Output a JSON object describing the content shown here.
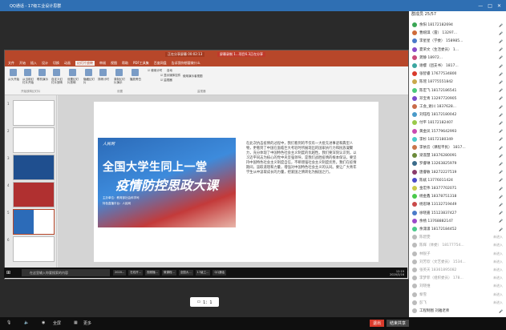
{
  "window": {
    "title": "QQ通话 - 17级工业设计思群"
  },
  "ppt": {
    "doc_label": "正在分享屏幕",
    "timer": "00:02:13",
    "recording": "屏幕录制 1...项目6.3正在分享",
    "tabs": [
      "文件",
      "开始",
      "插入",
      "设计",
      "切换",
      "动画",
      "幻灯片放映",
      "审阅",
      "视图",
      "帮助",
      "PDF工具集",
      "百度网盘",
      "告诉我你想要做什么"
    ],
    "active_tab": "幻灯片放映",
    "ribbon": [
      "从头开始",
      "从当前幻灯片开始",
      "联机演示",
      "自定义幻灯片放映",
      "设置幻灯片放映",
      "隐藏幻灯片",
      "排练计时",
      "录制幻灯片演示",
      "播放旁白",
      "使用计时",
      "显示媒体控件",
      "监视器",
      "自动",
      "使用演示者视图"
    ],
    "ribbon_groups": [
      "开始放映幻灯片",
      "设置",
      "监视器"
    ],
    "thumb_numbers": [
      "1",
      "2",
      "3",
      "4",
      "5",
      "6"
    ],
    "slide": {
      "banner_org": "人民网",
      "banner_title1": "全国大学生同上一堂",
      "banner_title2": "疫情防控思政大课",
      "banner_host": "主办单位：教育部社会科学司",
      "banner_partner": "特色直播平台：人民网"
    },
    "slide_text": "在此次抗击疫情的过程中，我们看到的不仅有一大批先进事迹和典型人物，更看到了中国在面临巨大考验时所展现出的国家执行力和民族凝聚力，充分体现了中国特色社会主义制度的优越性。我们要深刻认识到，以习近平同志为核心的党中央坚强领导，是我们战胜疫情的根本保证。要坚持中国特色社会主义制度自信，不断增强社会主义制度优势。我们在疫情期间，汲取道理和力量，增强对中国特色社会主义的认同。要让广大青年学生从中汲取成长的力量，把爱国之情转化为报国之行。",
    "statusbar": "幻灯片 第5张，共 6 张  中文(中国)",
    "taskbar_search": "在这里输入你要搜索的内容",
    "taskbar_apps": [
      "2020...",
      "在线开...",
      "视频播...",
      "微课程...",
      "全国大...",
      "17级工...",
      "QQ通话"
    ],
    "clock_time": "12:19",
    "clock_date": "2020/3/16"
  },
  "zoom": {
    "label": "1：1"
  },
  "controls": [
    "静音",
    "摄像头",
    "全屏",
    "邀请",
    "更多"
  ],
  "end_label": "退出",
  "end_share": "结束共享",
  "members": {
    "count": "群成员 25/57",
    "list": [
      {
        "name": "余阳 18172182694",
        "status": "",
        "color": "#3aa655"
      },
      {
        "name": "曹婉琪（雷） 13297...",
        "status": "",
        "color": "#cf6b3a"
      },
      {
        "name": "李星星（学委） 158985...",
        "status": "",
        "color": "#4a79c9"
      },
      {
        "name": "夏荣文（生活委员） 1...",
        "status": "",
        "color": "#8a4ac9"
      },
      {
        "name": "龚静 18972...",
        "status": "",
        "color": "#c94a7a"
      },
      {
        "name": "谢樱（团支书） 1817...",
        "status": "",
        "color": "#3aa6a0"
      },
      {
        "name": "张智睿 17677534800",
        "status": "",
        "color": "#d93a2b"
      },
      {
        "name": "陈瑶 18775551842",
        "status": "",
        "color": "#c9a84a"
      },
      {
        "name": "陈宏飞 18172186541",
        "status": "",
        "color": "#4ac97a"
      },
      {
        "name": "邓宝青 13297720905",
        "status": "",
        "color": "#7a4ac9"
      },
      {
        "name": "工会_谢川 1837628...",
        "status": "",
        "color": "#c96b4a"
      },
      {
        "name": "刘钰晗 18172180042",
        "status": "",
        "color": "#4a9ac9"
      },
      {
        "name": "付平 18172182407",
        "status": "",
        "color": "#9ac94a"
      },
      {
        "name": "黄金凤 15779642993",
        "status": "",
        "color": "#c94ab0"
      },
      {
        "name": "李杉 18172180349",
        "status": "",
        "color": "#4ac9c9"
      },
      {
        "name": "李依云（课程平民） 1817...",
        "status": "",
        "color": "#c9744a"
      },
      {
        "name": "梁淑慧 18376280091",
        "status": "",
        "color": "#6b8a3a"
      },
      {
        "name": "罗睿琳 13263825979",
        "status": "",
        "color": "#3a6b8a"
      },
      {
        "name": "唐睿敏 18272227519",
        "status": "",
        "color": "#8a3a6b"
      },
      {
        "name": "陈斌 13776011424",
        "status": "",
        "color": "#4a4ac9"
      },
      {
        "name": "金宏伟 18377702071",
        "status": "",
        "color": "#c9c94a"
      },
      {
        "name": "杨金鑫 18378751318",
        "status": "",
        "color": "#4ac94a"
      },
      {
        "name": "杨思琳 13132719449",
        "status": "",
        "color": "#c94a4a"
      },
      {
        "name": "徐晓嘉 15123837427",
        "status": "",
        "color": "#4a7ac9"
      },
      {
        "name": "余杨 13768882147",
        "status": "",
        "color": "#9a4ac9"
      },
      {
        "name": "余潇潇 18172184452",
        "status": "",
        "color": "#4ac98a"
      },
      {
        "name": "陈碧雯",
        "status": "未进入",
        "color": "#bbbbbb"
      },
      {
        "name": "陈辉（体委） 18177754...",
        "status": "未进入",
        "color": "#bbbbbb"
      },
      {
        "name": "林锐子",
        "status": "未进入",
        "color": "#bbbbbb"
      },
      {
        "name": "刘芳欣（文艺委员） 1534...",
        "status": "未进入",
        "color": "#bbbbbb"
      },
      {
        "name": "张英天 18361895082",
        "status": "未进入",
        "color": "#bbbbbb"
      },
      {
        "name": "李梦菲（组织委员） 178...",
        "status": "未进入",
        "color": "#bbbbbb"
      },
      {
        "name": "刘晓维",
        "status": "未进入",
        "color": "#bbbbbb"
      },
      {
        "name": "黎雪",
        "status": "未进入",
        "color": "#bbbbbb"
      },
      {
        "name": "彭飞",
        "status": "未进入",
        "color": "#bbbbbb"
      },
      {
        "name": "工程制图 刘雅老师",
        "status": "",
        "color": "#bbbbbb"
      }
    ]
  }
}
